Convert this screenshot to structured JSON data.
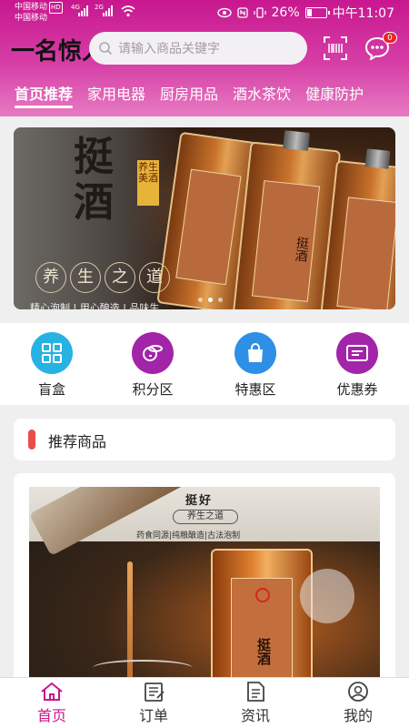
{
  "status_bar": {
    "carrier_1": "中国移动",
    "carrier_1_badge": "HD",
    "carrier_2": "中国移动",
    "network_1": "4G",
    "network_2": "2G",
    "battery": "26%",
    "battery_level": 0.26,
    "time": "中午11:07"
  },
  "header": {
    "logo": "一名惊人",
    "search_placeholder": "请输入商品关键字",
    "message_count": "0"
  },
  "tabs": [
    {
      "label": "首页推荐",
      "active": true
    },
    {
      "label": "家用电器"
    },
    {
      "label": "厨房用品"
    },
    {
      "label": "酒水茶饮"
    },
    {
      "label": "健康防护"
    }
  ],
  "banner": {
    "title": "挺酒",
    "seal": "养生美酒",
    "slogan": [
      "养",
      "生",
      "之",
      "道"
    ],
    "tagline": "精心泡制 | 用心酿造 | 品味生",
    "bottle_label": "挺酒",
    "page_count": 3,
    "active_page": 1
  },
  "quick_nav": [
    {
      "label": "盲盒",
      "color": "#27b2e3",
      "icon": "grid-icon"
    },
    {
      "label": "积分区",
      "color": "#a224a9",
      "icon": "coins-icon"
    },
    {
      "label": "特惠区",
      "color": "#2e8fe7",
      "icon": "shopping-bag-icon"
    },
    {
      "label": "优惠券",
      "color": "#a224a9",
      "icon": "ticket-icon"
    }
  ],
  "section": {
    "title": "推荐商品"
  },
  "product": {
    "brand": "挺好",
    "slogan": "养生之道",
    "features": "药食同源|纯粮酿造|古法泡制",
    "bottle_label": "挺酒"
  },
  "bottom_nav": [
    {
      "label": "首页",
      "icon": "home-icon",
      "active": true
    },
    {
      "label": "订单",
      "icon": "order-icon"
    },
    {
      "label": "资讯",
      "icon": "news-icon"
    },
    {
      "label": "我的",
      "icon": "profile-icon"
    }
  ],
  "colors": {
    "brand": "#c9168f",
    "accent_red": "#e94e4a"
  }
}
